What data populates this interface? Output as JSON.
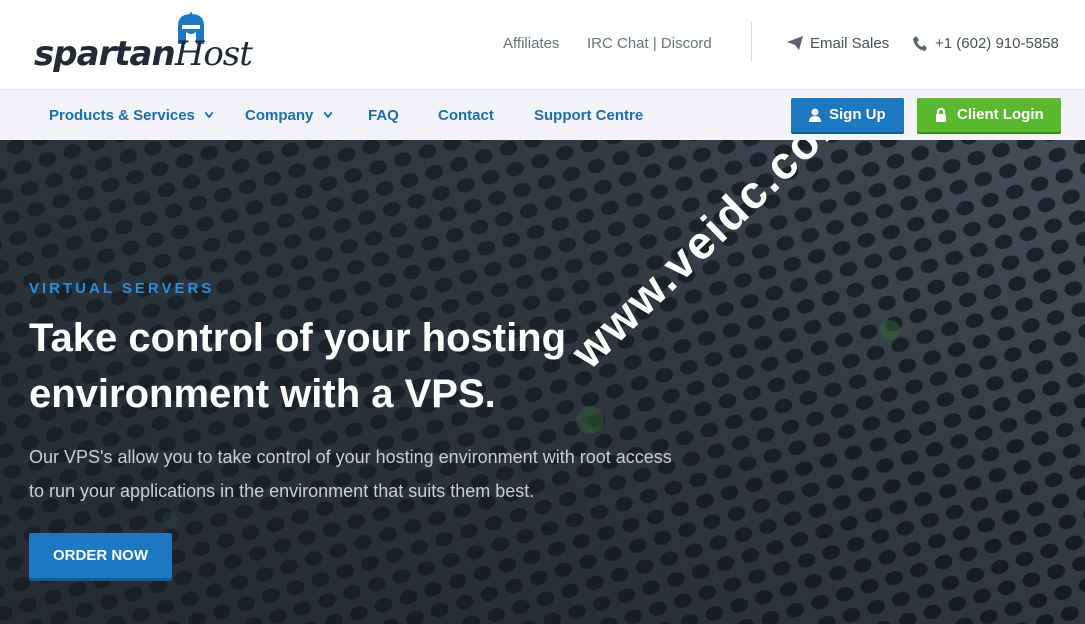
{
  "brand": {
    "logo_main": "spartan",
    "logo_accent": "Host",
    "logo_icon": "spartan-helmet-icon",
    "logo_color": "#222a35",
    "helmet_color": "#1c78c0"
  },
  "top_links": {
    "affiliates": "Affiliates",
    "irc": "IRC Chat | Discord"
  },
  "contact": {
    "email_label": "Email Sales",
    "email_icon": "paper-plane-icon",
    "phone": "+1 (602) 910-5858",
    "phone_icon": "phone-icon"
  },
  "nav": {
    "items": [
      {
        "label": "Products & Services",
        "has_dropdown": true
      },
      {
        "label": "Company",
        "has_dropdown": true
      },
      {
        "label": "FAQ",
        "has_dropdown": false
      },
      {
        "label": "Contact",
        "has_dropdown": false
      },
      {
        "label": "Support Centre",
        "has_dropdown": false
      }
    ],
    "signup_label": "Sign Up",
    "signup_icon": "user-icon",
    "login_label": "Client Login",
    "login_icon": "lock-icon"
  },
  "hero": {
    "eyebrow": "VIRTUAL SERVERS",
    "headline": "Take control of your hosting environment with a VPS.",
    "subtext": "Our VPS's allow you to take control of your hosting environment with root access to run your applications in the environment that suits them best.",
    "cta": "ORDER NOW"
  },
  "watermark": "www.veidc.com",
  "colors": {
    "nav_text": "#1a6fb0",
    "signup_bg": "#1c78c0",
    "login_bg": "#5bb92f",
    "eyebrow": "#2b8ed8",
    "cta_bg": "#1c78c0"
  }
}
